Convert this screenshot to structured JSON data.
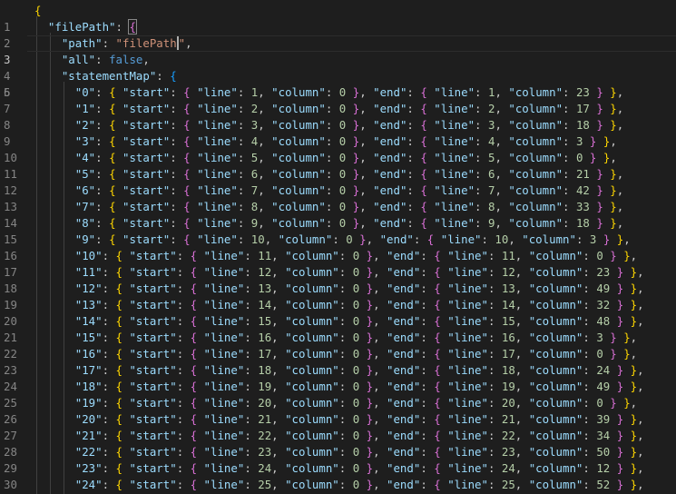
{
  "editor": {
    "active_line": 3,
    "line_numbers": [
      "1",
      "2",
      "3",
      "4",
      "5",
      "6",
      "7",
      "8",
      "9",
      "10",
      "11",
      "12",
      "13",
      "14",
      "15",
      "16",
      "17",
      "18",
      "19",
      "20",
      "21",
      "22",
      "23",
      "24",
      "25",
      "26",
      "27",
      "28",
      "29",
      "30"
    ],
    "header": {
      "open_brace": "{",
      "filepath_key": "\"filePath\"",
      "path_key": "\"path\"",
      "path_value_before_cursor": "\"filePath",
      "path_value_after_cursor": "\"",
      "all_key": "\"all\"",
      "all_value": "false",
      "statementmap_key": "\"statementMap\""
    },
    "statements": [
      {
        "id": "\"0\"",
        "start_line": "1",
        "start_col": "0",
        "end_line": "1",
        "end_col": "23"
      },
      {
        "id": "\"1\"",
        "start_line": "2",
        "start_col": "0",
        "end_line": "2",
        "end_col": "17"
      },
      {
        "id": "\"2\"",
        "start_line": "3",
        "start_col": "0",
        "end_line": "3",
        "end_col": "18"
      },
      {
        "id": "\"3\"",
        "start_line": "4",
        "start_col": "0",
        "end_line": "4",
        "end_col": "3"
      },
      {
        "id": "\"4\"",
        "start_line": "5",
        "start_col": "0",
        "end_line": "5",
        "end_col": "0"
      },
      {
        "id": "\"5\"",
        "start_line": "6",
        "start_col": "0",
        "end_line": "6",
        "end_col": "21"
      },
      {
        "id": "\"6\"",
        "start_line": "7",
        "start_col": "0",
        "end_line": "7",
        "end_col": "42"
      },
      {
        "id": "\"7\"",
        "start_line": "8",
        "start_col": "0",
        "end_line": "8",
        "end_col": "33"
      },
      {
        "id": "\"8\"",
        "start_line": "9",
        "start_col": "0",
        "end_line": "9",
        "end_col": "18"
      },
      {
        "id": "\"9\"",
        "start_line": "10",
        "start_col": "0",
        "end_line": "10",
        "end_col": "3"
      },
      {
        "id": "\"10\"",
        "start_line": "11",
        "start_col": "0",
        "end_line": "11",
        "end_col": "0"
      },
      {
        "id": "\"11\"",
        "start_line": "12",
        "start_col": "0",
        "end_line": "12",
        "end_col": "23"
      },
      {
        "id": "\"12\"",
        "start_line": "13",
        "start_col": "0",
        "end_line": "13",
        "end_col": "49"
      },
      {
        "id": "\"13\"",
        "start_line": "14",
        "start_col": "0",
        "end_line": "14",
        "end_col": "32"
      },
      {
        "id": "\"14\"",
        "start_line": "15",
        "start_col": "0",
        "end_line": "15",
        "end_col": "48"
      },
      {
        "id": "\"15\"",
        "start_line": "16",
        "start_col": "0",
        "end_line": "16",
        "end_col": "3"
      },
      {
        "id": "\"16\"",
        "start_line": "17",
        "start_col": "0",
        "end_line": "17",
        "end_col": "0"
      },
      {
        "id": "\"17\"",
        "start_line": "18",
        "start_col": "0",
        "end_line": "18",
        "end_col": "24"
      },
      {
        "id": "\"18\"",
        "start_line": "19",
        "start_col": "0",
        "end_line": "19",
        "end_col": "49"
      },
      {
        "id": "\"19\"",
        "start_line": "20",
        "start_col": "0",
        "end_line": "20",
        "end_col": "0"
      },
      {
        "id": "\"20\"",
        "start_line": "21",
        "start_col": "0",
        "end_line": "21",
        "end_col": "39"
      },
      {
        "id": "\"21\"",
        "start_line": "22",
        "start_col": "0",
        "end_line": "22",
        "end_col": "34"
      },
      {
        "id": "\"22\"",
        "start_line": "23",
        "start_col": "0",
        "end_line": "23",
        "end_col": "50"
      },
      {
        "id": "\"23\"",
        "start_line": "24",
        "start_col": "0",
        "end_line": "24",
        "end_col": "12"
      },
      {
        "id": "\"24\"",
        "start_line": "25",
        "start_col": "0",
        "end_line": "25",
        "end_col": "52"
      }
    ],
    "tokens": {
      "start_key": "\"start\"",
      "end_key": "\"end\"",
      "line_key": "\"line\"",
      "column_key": "\"column\""
    },
    "colors": {
      "background": "#1e1e1e",
      "key": "#9cdcfe",
      "string": "#ce9178",
      "number": "#b5cea8",
      "keyword": "#569cd6",
      "bracket_level_1": "#ffd700",
      "bracket_level_2": "#da70d6",
      "bracket_level_3": "#179fff"
    }
  }
}
